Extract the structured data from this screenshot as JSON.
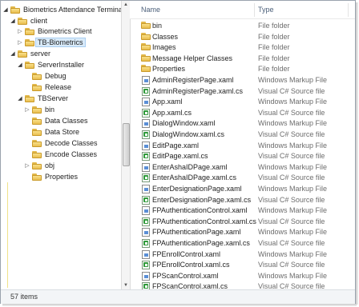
{
  "tree": {
    "items": [
      {
        "label": "Biometrics Attendance Terminal",
        "arrow": "◢",
        "open": true
      },
      {
        "label": "client",
        "arrow": "◢",
        "open": true
      },
      {
        "label": "Biometrics Client",
        "arrow": "▷",
        "open": false
      },
      {
        "label": "TB-Biometrics",
        "arrow": "▷",
        "open": false,
        "selected": true
      },
      {
        "label": "server",
        "arrow": "◢",
        "open": true
      },
      {
        "label": "ServerInstaller",
        "arrow": "◢",
        "open": true
      },
      {
        "label": "Debug",
        "arrow": "",
        "open": false
      },
      {
        "label": "Release",
        "arrow": "",
        "open": false
      },
      {
        "label": "TBServer",
        "arrow": "◢",
        "open": true
      },
      {
        "label": "bin",
        "arrow": "▷",
        "open": false
      },
      {
        "label": "Data Classes",
        "arrow": "",
        "open": false
      },
      {
        "label": "Data Store",
        "arrow": "",
        "open": false
      },
      {
        "label": "Decode Classes",
        "arrow": "",
        "open": false
      },
      {
        "label": "Encode Classes",
        "arrow": "",
        "open": false
      },
      {
        "label": "obj",
        "arrow": "▷",
        "open": false
      },
      {
        "label": "Properties",
        "arrow": "",
        "open": false
      }
    ]
  },
  "list": {
    "headers": {
      "name": "Name",
      "type": "Type"
    },
    "items": [
      {
        "name": "bin",
        "type": "File folder",
        "icon": "folder-icon"
      },
      {
        "name": "Classes",
        "type": "File folder",
        "icon": "folder-icon"
      },
      {
        "name": "Images",
        "type": "File folder",
        "icon": "folder-icon"
      },
      {
        "name": "Message Helper Classes",
        "type": "File folder",
        "icon": "folder-icon"
      },
      {
        "name": "Properties",
        "type": "File folder",
        "icon": "folder-icon"
      },
      {
        "name": "AdminRegisterPage.xaml",
        "type": "Windows Markup File",
        "icon": "xaml-file-icon"
      },
      {
        "name": "AdminRegisterPage.xaml.cs",
        "type": "Visual C# Source file",
        "icon": "cs-file-icon"
      },
      {
        "name": "App.xaml",
        "type": "Windows Markup File",
        "icon": "xaml-file-icon"
      },
      {
        "name": "App.xaml.cs",
        "type": "Visual C# Source file",
        "icon": "cs-file-icon"
      },
      {
        "name": "DialogWindow.xaml",
        "type": "Windows Markup File",
        "icon": "xaml-file-icon"
      },
      {
        "name": "DialogWindow.xaml.cs",
        "type": "Visual C# Source file",
        "icon": "cs-file-icon"
      },
      {
        "name": "EditPage.xaml",
        "type": "Windows Markup File",
        "icon": "xaml-file-icon"
      },
      {
        "name": "EditPage.xaml.cs",
        "type": "Visual C# Source file",
        "icon": "cs-file-icon"
      },
      {
        "name": "EnterAshaIDPage.xaml",
        "type": "Windows Markup File",
        "icon": "xaml-file-icon"
      },
      {
        "name": "EnterAshaIDPage.xaml.cs",
        "type": "Visual C# Source file",
        "icon": "cs-file-icon"
      },
      {
        "name": "EnterDesignationPage.xaml",
        "type": "Windows Markup File",
        "icon": "xaml-file-icon"
      },
      {
        "name": "EnterDesignationPage.xaml.cs",
        "type": "Visual C# Source file",
        "icon": "cs-file-icon"
      },
      {
        "name": "FPAuthenticationControl.xaml",
        "type": "Windows Markup File",
        "icon": "xaml-file-icon"
      },
      {
        "name": "FPAuthenticationControl.xaml.cs",
        "type": "Visual C# Source file",
        "icon": "cs-file-icon"
      },
      {
        "name": "FPAuthenticationPage.xaml",
        "type": "Windows Markup File",
        "icon": "xaml-file-icon"
      },
      {
        "name": "FPAuthenticationPage.xaml.cs",
        "type": "Visual C# Source file",
        "icon": "cs-file-icon"
      },
      {
        "name": "FPEnrollControl.xaml",
        "type": "Windows Markup File",
        "icon": "xaml-file-icon"
      },
      {
        "name": "FPEnrollControl.xaml.cs",
        "type": "Visual C# Source file",
        "icon": "cs-file-icon"
      },
      {
        "name": "FPScanControl.xaml",
        "type": "Windows Markup File",
        "icon": "xaml-file-icon"
      },
      {
        "name": "FPScanControl.xaml.cs",
        "type": "Visual C# Source file",
        "icon": "cs-file-icon"
      }
    ]
  },
  "status": {
    "text": "57 items"
  },
  "colors": {
    "folder": "#f0c850",
    "selection": "#d8eaf9",
    "header_text": "#4c607a"
  }
}
